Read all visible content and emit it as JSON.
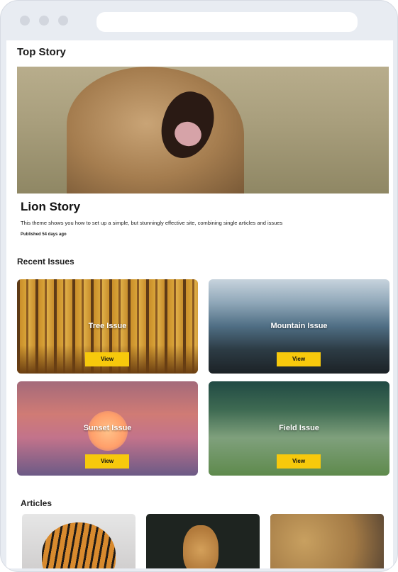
{
  "top_story": {
    "heading": "Top Story",
    "title": "Lion Story",
    "description": "This theme shows you how to set up a simple, but stunningly effective site, combining single articles and issues",
    "published": "Published 54 days ago"
  },
  "recent_issues": {
    "heading": "Recent Issues",
    "items": [
      {
        "label": "Tree Issue",
        "button": "View"
      },
      {
        "label": "Mountain Issue",
        "button": "View"
      },
      {
        "label": "Sunset Issue",
        "button": "View"
      },
      {
        "label": "Field Issue",
        "button": "View"
      }
    ]
  },
  "articles": {
    "heading": "Articles"
  },
  "colors": {
    "accent_button": "#f7c90c",
    "frame": "#e8ecf2"
  }
}
